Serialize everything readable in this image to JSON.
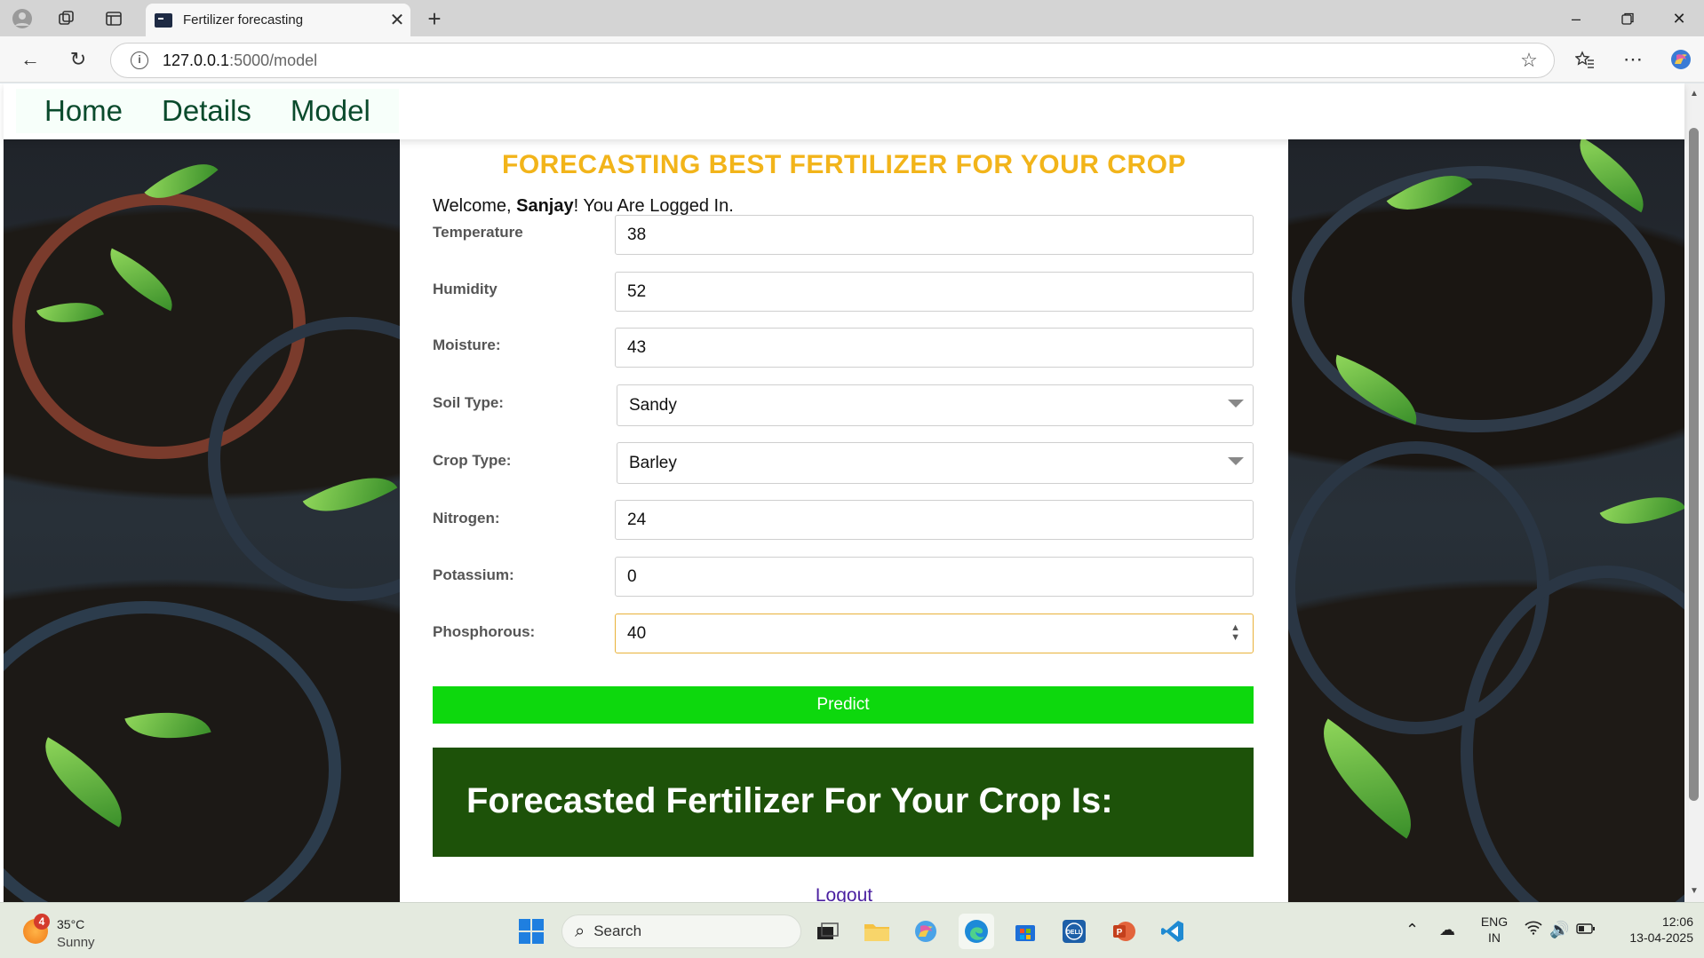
{
  "browser": {
    "tab_title": "Fertilizer forecasting",
    "tab_close": "✕",
    "new_tab": "+",
    "url_host": "127.0.0.1",
    "url_rest": ":5000/model"
  },
  "site_nav": {
    "links": [
      "Home",
      "Details",
      "Model"
    ]
  },
  "page": {
    "heading": "FORECASTING BEST FERTILIZER FOR YOUR CROP",
    "welcome_prefix": "Welcome, ",
    "welcome_user": "Sanjay",
    "welcome_suffix": "! You Are Logged In.",
    "fields": [
      {
        "label": "Temperature",
        "value": "38"
      },
      {
        "label": "Humidity",
        "value": "52"
      },
      {
        "label": "Moisture:",
        "value": "43"
      },
      {
        "label": "Soil Type:",
        "value": "Sandy"
      },
      {
        "label": "Crop Type:",
        "value": "Barley"
      },
      {
        "label": "Nitrogen:",
        "value": "24"
      },
      {
        "label": "Potassium:",
        "value": "0"
      },
      {
        "label": "Phosphorous:",
        "value": "40"
      }
    ],
    "predict_label": "Predict",
    "result_text": "Forecasted Fertilizer For Your Crop Is:",
    "logout_label": "Logout",
    "colors": {
      "heading": "#f2b41a",
      "predict": "#0dd80d",
      "result_bg": "#1d5209"
    }
  },
  "taskbar": {
    "weather_badge": "4",
    "weather_temp": "35°C",
    "weather_cond": "Sunny",
    "search_label": "Search",
    "lang_top": "ENG",
    "lang_bottom": "IN",
    "time": "12:06",
    "date": "13-04-2025",
    "icons": [
      "windows-start-icon",
      "task-view-icon",
      "file-explorer-icon",
      "copilot-icon",
      "edge-icon",
      "store-icon",
      "dell-icon",
      "powerpoint-icon",
      "vscode-icon"
    ]
  }
}
